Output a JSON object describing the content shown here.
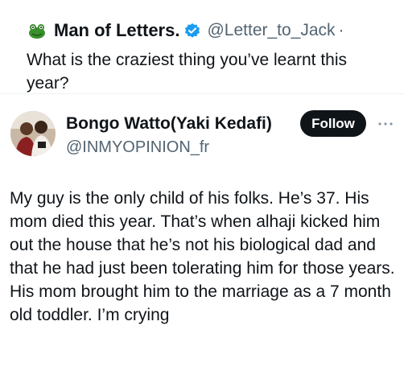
{
  "quoted_tweet": {
    "avatar_icon": "frog-avatar-icon",
    "name": "Man of Letters.",
    "verified_icon": "verified-badge-icon",
    "handle": "@Letter_to_Jack",
    "separator": "·",
    "text": "What is the craziest thing you’ve learnt this year?"
  },
  "tweet": {
    "avatar_icon": "profile-photo-avatar",
    "author_name": "Bongo Watto(Yaki Kedafi)",
    "author_handle": "@INMYOPINION_fr",
    "follow_label": "Follow",
    "more_icon": "more-options-icon",
    "text": "My guy is the only child of his folks. He’s 37. His mom died this year. That’s when alhaji kicked him out the house that he’s not his biological dad and that he had just been tolerating him for those years. His mom brought him to the marriage as a 7 month old toddler. I’m crying"
  },
  "colors": {
    "text_primary": "#0f1419",
    "text_secondary": "#536471",
    "verified_blue": "#1d9bf0",
    "follow_button_bg": "#0f1419",
    "follow_button_text": "#ffffff"
  }
}
